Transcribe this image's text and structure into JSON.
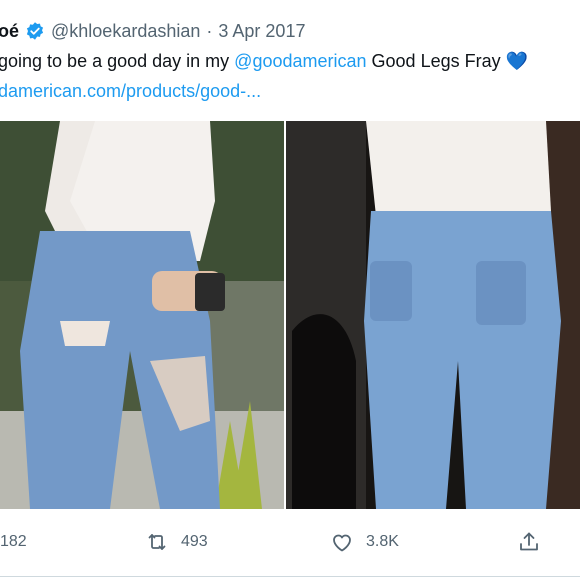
{
  "tweet": {
    "display_name": "oé",
    "handle": "@khloekardashian",
    "separator": "·",
    "date": "3 Apr 2017",
    "text_part1": "going to be a good day in my ",
    "mention": "@goodamerican",
    "text_part2": " Good Legs Fray ",
    "heart": "💙",
    "link": "damerican.com/products/good-..."
  },
  "actions": {
    "reply_count": "182",
    "retweet_count": "493",
    "like_count": "3.8K"
  },
  "colors": {
    "accent": "#1d9bf0",
    "muted": "#536471",
    "text": "#0f1419"
  },
  "icons": {
    "verified": "verified-badge-icon",
    "retweet": "retweet-icon",
    "like": "heart-icon",
    "share": "share-icon"
  }
}
